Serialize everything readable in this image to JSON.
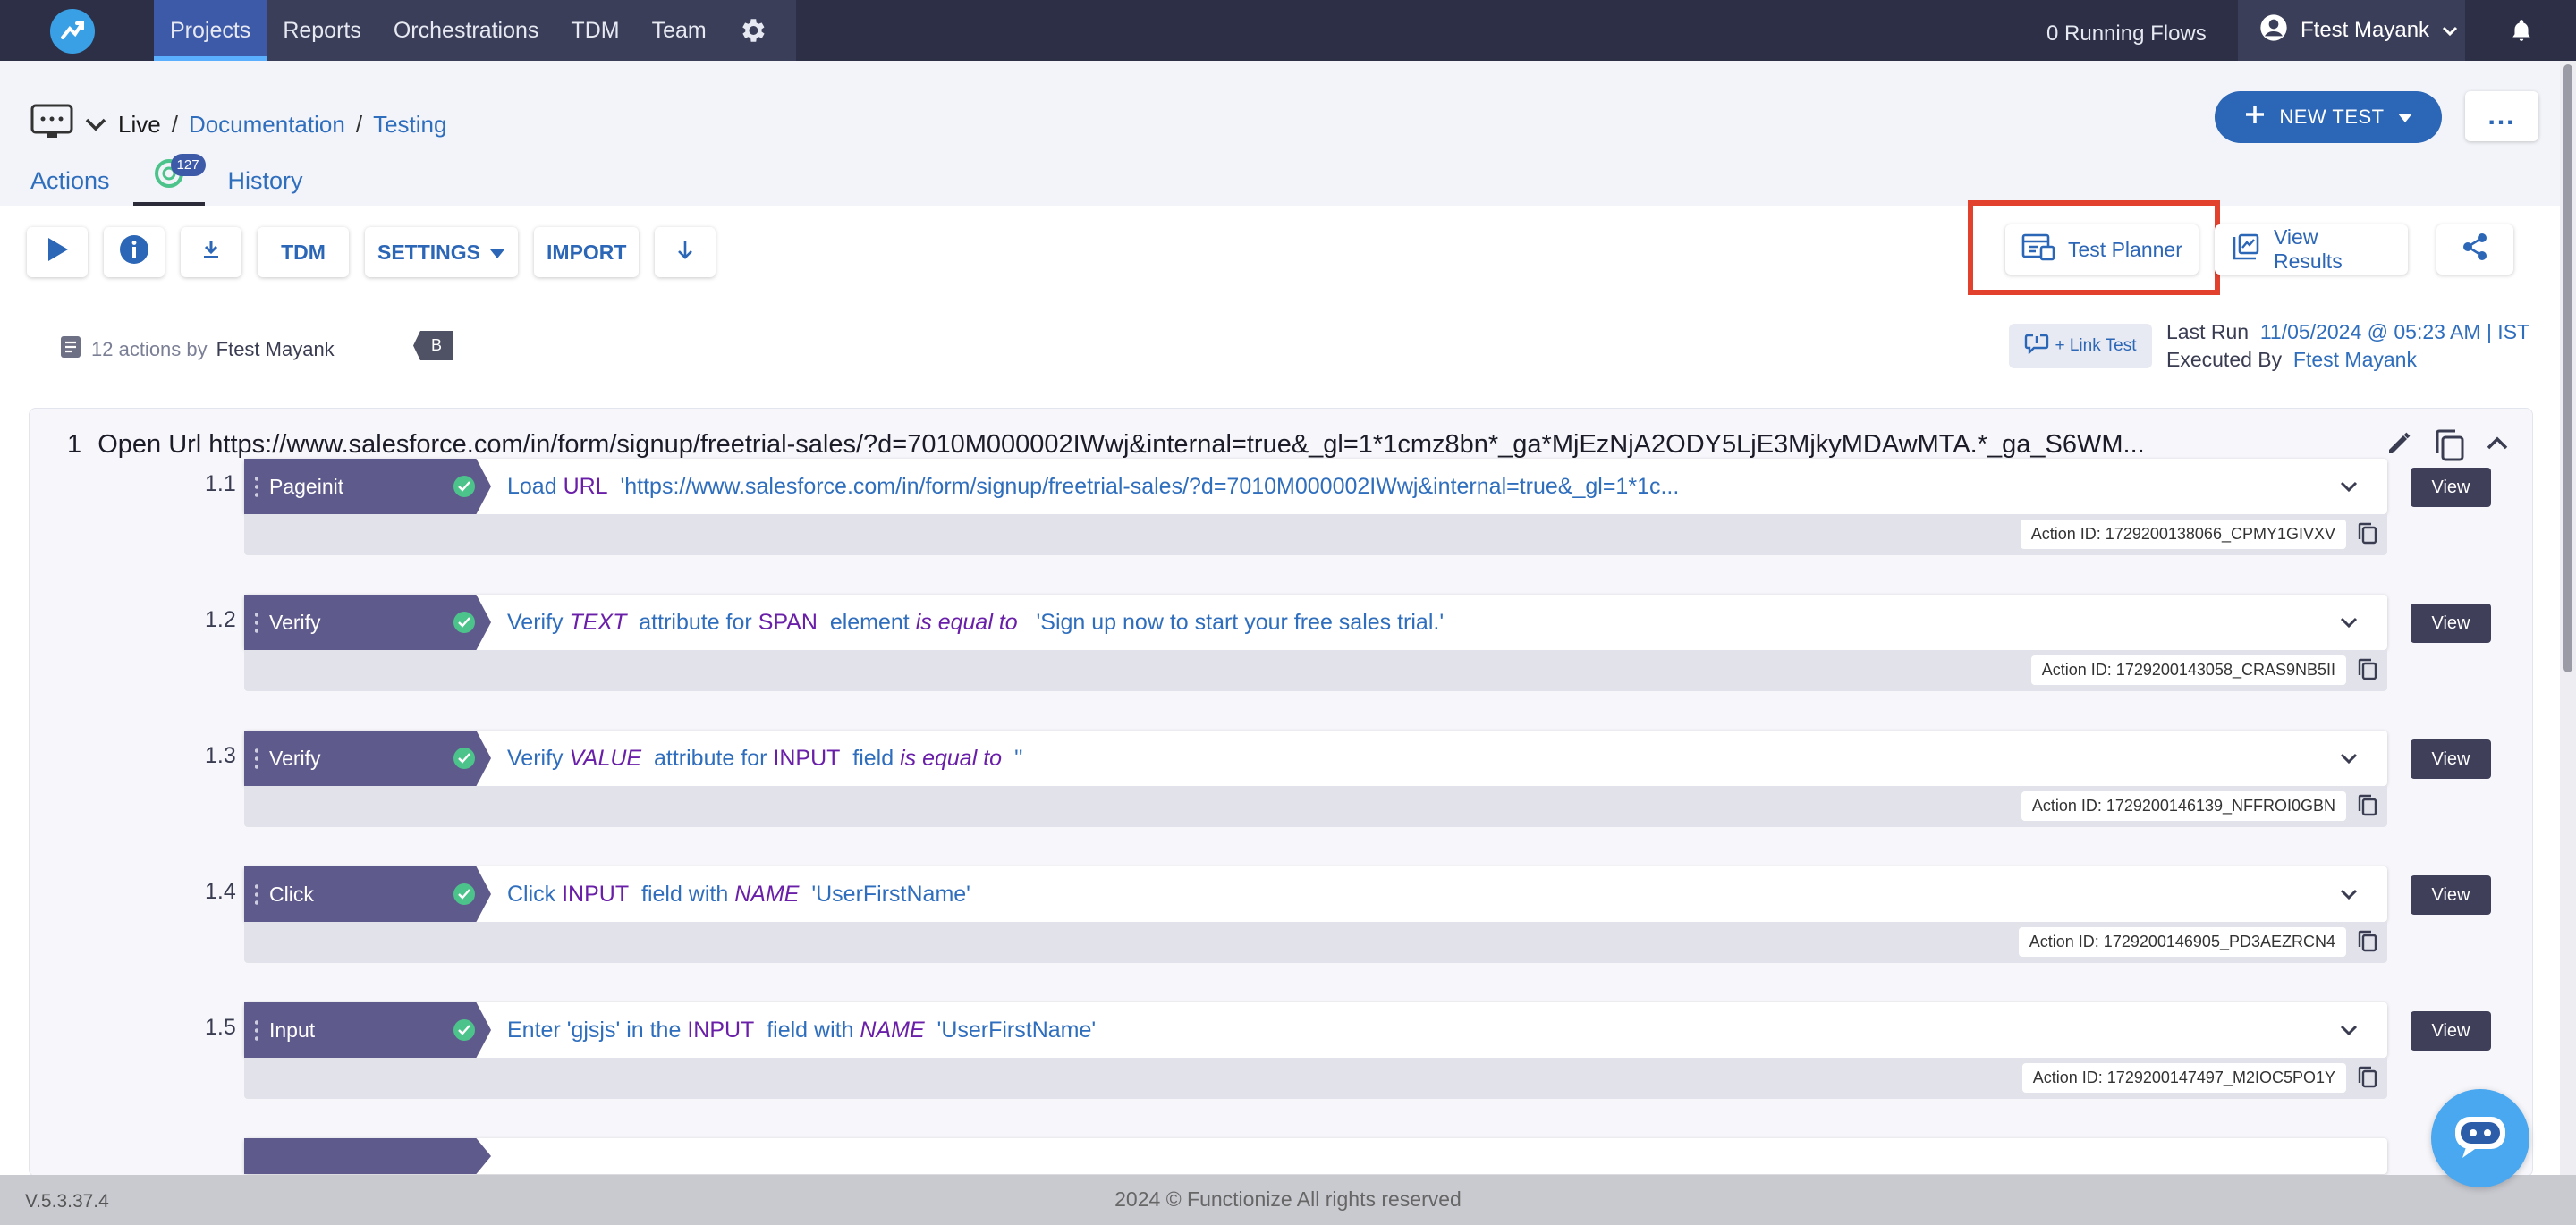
{
  "nav": {
    "items": [
      {
        "label": "Projects"
      },
      {
        "label": "Reports"
      },
      {
        "label": "Orchestrations"
      },
      {
        "label": "TDM"
      },
      {
        "label": "Team"
      }
    ],
    "running_flows": "0 Running Flows",
    "user_name": "Ftest Mayank"
  },
  "breadcrumb": {
    "env": "Live",
    "project": "Documentation",
    "sep": "/",
    "page": "Testing"
  },
  "header": {
    "new_test_label": "NEW TEST",
    "more_label": "...",
    "tabs": {
      "actions": "Actions",
      "browser_badge": "127",
      "history": "History"
    }
  },
  "toolbar": {
    "tdm": "TDM",
    "settings": "SETTINGS",
    "import": "IMPORT",
    "test_planner": "Test Planner",
    "view_results": "View Results"
  },
  "meta": {
    "actions_count": "12 actions by",
    "author": "Ftest Mayank",
    "badge": "B",
    "link_test": "+ Link Test",
    "last_run_label": "Last Run",
    "last_run_value": "11/05/2024 @ 05:23 AM | IST",
    "executed_by_label": "Executed By",
    "executed_by_value": "Ftest Mayank"
  },
  "step": {
    "number": "1",
    "title": "Open Url https://www.salesforce.com/in/form/signup/freetrial-sales/?d=7010M000002IWwj&internal=true&_gl=1*1cmz8bn*_ga*MjEzNjA2ODY5LjE3MjkyMDAwMTA.*_ga_S6WM..."
  },
  "actions": [
    {
      "num": "1.1",
      "tag": "Pageinit",
      "parts": [
        [
          "t",
          "Load "
        ],
        [
          "k",
          "URL"
        ],
        [
          "t",
          "  'https://www.salesforce.com/in/form/signup/freetrial-sales/?d=7010M000002IWwj&internal=true&_gl=1*1c..."
        ]
      ],
      "action_id": "Action ID: 1729200138066_CPMY1GIVXV",
      "view": "View"
    },
    {
      "num": "1.2",
      "tag": "Verify",
      "parts": [
        [
          "t",
          "Verify "
        ],
        [
          "i",
          "TEXT"
        ],
        [
          "t",
          "  attribute for "
        ],
        [
          "k",
          "SPAN"
        ],
        [
          "t",
          "  element "
        ],
        [
          "i",
          "is equal to"
        ],
        [
          "t",
          "   'Sign up now to start your free sales trial.'"
        ]
      ],
      "action_id": "Action ID: 1729200143058_CRAS9NB5II",
      "view": "View"
    },
    {
      "num": "1.3",
      "tag": "Verify",
      "parts": [
        [
          "t",
          "Verify "
        ],
        [
          "i",
          "VALUE"
        ],
        [
          "t",
          "  attribute for "
        ],
        [
          "k",
          "INPUT"
        ],
        [
          "t",
          "  field "
        ],
        [
          "i",
          "is equal to"
        ],
        [
          "t",
          "  ''"
        ]
      ],
      "action_id": "Action ID: 1729200146139_NFFROI0GBN",
      "view": "View"
    },
    {
      "num": "1.4",
      "tag": "Click",
      "parts": [
        [
          "t",
          "Click "
        ],
        [
          "k",
          "INPUT"
        ],
        [
          "t",
          "  field with "
        ],
        [
          "i",
          "NAME"
        ],
        [
          "t",
          "  'UserFirstName'"
        ]
      ],
      "action_id": "Action ID: 1729200146905_PD3AEZRCN4",
      "view": "View"
    },
    {
      "num": "1.5",
      "tag": "Input",
      "parts": [
        [
          "t",
          "Enter 'gjsjs' in the "
        ],
        [
          "k",
          "INPUT"
        ],
        [
          "t",
          "  field with "
        ],
        [
          "i",
          "NAME"
        ],
        [
          "t",
          "  'UserFirstName'"
        ]
      ],
      "action_id": "Action ID: 1729200147497_M2IOC5PO1Y",
      "view": "View"
    }
  ],
  "footer": {
    "version": "V.5.3.37.4",
    "copyright": "2024 © Functionize All rights reserved"
  },
  "colors": {
    "nav_bg": "#2c2f45",
    "nav_active": "#3c5aa8",
    "primary": "#2c66b6",
    "tag_bg": "#5f5a8c",
    "check": "#4cc38a",
    "highlight_border": "#e2412e"
  },
  "icons": [
    "logo-icon",
    "gear-icon",
    "user-icon",
    "chevron-down-icon",
    "bell-icon",
    "monitor-icon",
    "plus-icon",
    "chrome-icon",
    "play-icon",
    "info-icon",
    "download-icon",
    "arrow-down-icon",
    "test-planner-icon",
    "view-results-icon",
    "share-icon",
    "document-icon",
    "link-icon",
    "edit-icon",
    "copy-icon",
    "chevron-up-icon",
    "check-icon",
    "chat-icon"
  ]
}
